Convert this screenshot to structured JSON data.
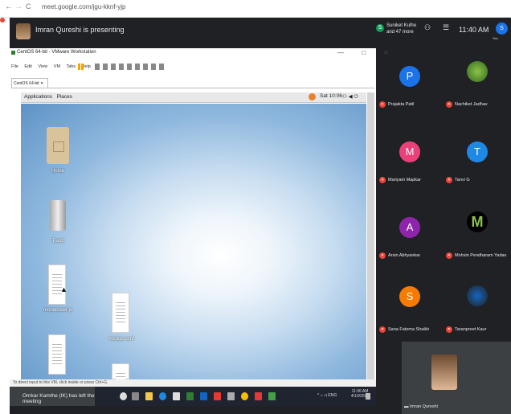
{
  "browser": {
    "url": "meet.google.com/jgu-kknf-yjp",
    "nav_back": "←",
    "nav_forward": "→",
    "nav_reload": "C"
  },
  "presenter": {
    "text": "Imran Qureshi is presenting"
  },
  "vm": {
    "title": "CentOS 64-bit - VMware Workstation",
    "window_controls": "—  □  ✕",
    "menu": [
      "File",
      "Edit",
      "View",
      "VM",
      "Tabs",
      "Help"
    ],
    "tab_label": "CentOS 64-bit"
  },
  "gnome": {
    "applications": "Applications",
    "places": "Places",
    "clock": "Sat 10:06"
  },
  "desktop_icons": {
    "home": "Home",
    "trash": "Trash",
    "file1": "mongouser.js",
    "file2": "mongo.conf"
  },
  "vm_status": "To direct input to this VM, click inside or press Ctrl+G.",
  "toast": "Omkar Kamthe (IK) has left the meeting",
  "tray": {
    "lang": "ENG",
    "time": "11:06 AM",
    "date": "4/10/2021"
  },
  "meet": {
    "others_top": "Suniket Kulhe",
    "others_bottom": "and 47 more",
    "others_initial": "S",
    "time": "11:40 AM",
    "user_initial": "S",
    "you_label": "You"
  },
  "participants": [
    {
      "name": "Prajakta Patil",
      "initial": "P",
      "color": "#1a73e8"
    },
    {
      "name": "Nachiket Jadhav",
      "initial": "",
      "color": ""
    },
    {
      "name": "Mariyam Mapkar",
      "initial": "M",
      "color": "#ec407a"
    },
    {
      "name": "Tanvi G",
      "initial": "T",
      "color": "#1e88e5"
    },
    {
      "name": "Arsin Abhyankar",
      "initial": "A",
      "color": "#8e24aa"
    },
    {
      "name": "Mohsin Pendharam Yadav",
      "initial": "",
      "color": ""
    },
    {
      "name": "Sana Fatema Shaikh",
      "initial": "S",
      "color": "#f57c00"
    },
    {
      "name": "Taranpreet Kaur",
      "initial": "",
      "color": ""
    }
  ],
  "self_name": "Imran Qureshi"
}
